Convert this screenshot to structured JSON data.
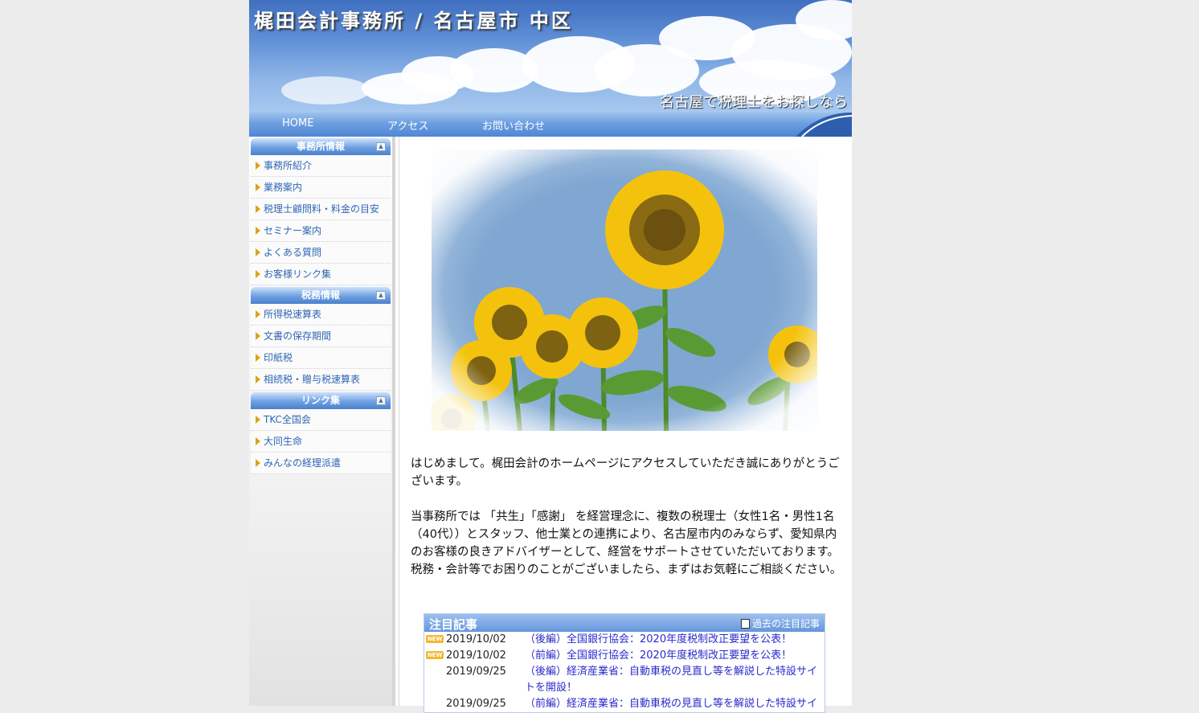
{
  "header": {
    "title": "梶田会計事務所 / 名古屋市 中区",
    "tagline": "名古屋で税理士をお探しなら"
  },
  "nav": {
    "items": [
      "HOME",
      "アクセス",
      "お問い合わせ"
    ]
  },
  "sidebar": {
    "sections": [
      {
        "title": "事務所情報",
        "items": [
          "事務所紹介",
          "業務案内",
          "税理士顧問料・料金の目安",
          "セミナー案内",
          "よくある質問",
          "お客様リンク集"
        ]
      },
      {
        "title": "税務情報",
        "items": [
          "所得税速算表",
          "文書の保存期間",
          "印紙税",
          "相続税・贈与税速算表"
        ]
      },
      {
        "title": "リンク集",
        "items": [
          "TKC全国会",
          "大同生命",
          "みんなの経理派遣"
        ]
      }
    ]
  },
  "main": {
    "intro": [
      "はじめまして。梶田会計のホームページにアクセスしていただき誠にありがとうございます。",
      "当事務所では 「共生」「感謝」 を経営理念に、複数の税理士（女性1名・男性1名（40代））とスタッフ、他士業との連携により、名古屋市内のみならず、愛知県内のお客様の良きアドバイザーとして、経営をサポートさせていただいております。",
      "税務・会計等でお困りのことがございましたら、まずはお気軽にご相談ください。"
    ]
  },
  "featured": {
    "title": "注目記事",
    "past_link": "過去の注目記事",
    "new_badge": "NEW",
    "articles": [
      {
        "date": "2019/10/02",
        "new": true,
        "title": "（後編）全国銀行協会：2020年度税制改正要望を公表！"
      },
      {
        "date": "2019/10/02",
        "new": true,
        "title": "（前編）全国銀行協会：2020年度税制改正要望を公表！"
      },
      {
        "date": "2019/09/25",
        "new": false,
        "title": "（後編）経済産業省：自動車税の見直し等を解説した特設サイトを開設！"
      },
      {
        "date": "2019/09/25",
        "new": false,
        "title": "（前編）経済産業省：自動車税の見直し等を解説した特設サイ"
      }
    ]
  },
  "colors": {
    "nav_blue": "#4f86d4",
    "link_blue": "#2f66b3",
    "arrow_orange": "#e1a017",
    "new_badge": "#f2b830"
  },
  "icons": [
    "collapse-icon",
    "arrow-icon",
    "document-icon",
    "new-badge"
  ]
}
